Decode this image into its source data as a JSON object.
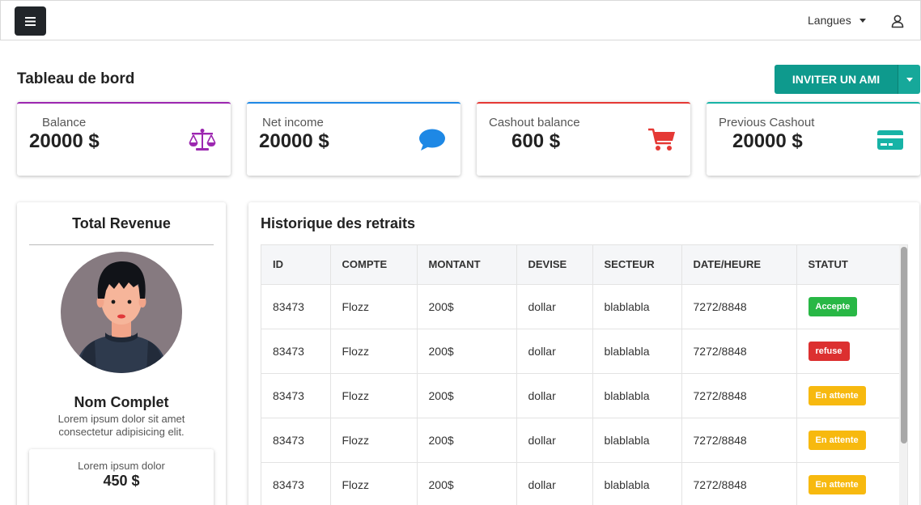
{
  "header": {
    "language_label": "Langues"
  },
  "page": {
    "title": "Tableau de bord",
    "invite_label": "INVITER UN AMI"
  },
  "cards": [
    {
      "label": "Balance",
      "value": "20000 $",
      "icon": "scale-icon",
      "color": "#9c27b0"
    },
    {
      "label": "Net income",
      "value": "20000 $",
      "icon": "chat-bubble-icon",
      "color": "#1e88e5"
    },
    {
      "label": "Cashout balance",
      "value": "600 $",
      "icon": "cart-icon",
      "color": "#e53935"
    },
    {
      "label": "Previous Cashout",
      "value": "20000 $",
      "icon": "credit-card-icon",
      "color": "#17b3a6"
    }
  ],
  "revenue": {
    "title": "Total Revenue",
    "name": "Nom Complet",
    "description": "Lorem ipsum dolor sit amet consectetur adipisicing elit.",
    "mini_label": "Lorem ipsum dolor",
    "mini_value": "450 $"
  },
  "history": {
    "title": "Historique des retraits",
    "columns": [
      "ID",
      "COMPTE",
      "MONTANT",
      "DEVISE",
      "SECTEUR",
      "DATE/HEURE",
      "STATUT"
    ],
    "rows": [
      {
        "id": "83473",
        "compte": "Flozz",
        "montant": "200$",
        "devise": "dollar",
        "secteur": "blablabla",
        "date": "7272/8848",
        "statut": "Accepte",
        "statut_color": "#28b745"
      },
      {
        "id": "83473",
        "compte": "Flozz",
        "montant": "200$",
        "devise": "dollar",
        "secteur": "blablabla",
        "date": "7272/8848",
        "statut": "refuse",
        "statut_color": "#dc3030"
      },
      {
        "id": "83473",
        "compte": "Flozz",
        "montant": "200$",
        "devise": "dollar",
        "secteur": "blablabla",
        "date": "7272/8848",
        "statut": "En attente",
        "statut_color": "#f7b90f"
      },
      {
        "id": "83473",
        "compte": "Flozz",
        "montant": "200$",
        "devise": "dollar",
        "secteur": "blablabla",
        "date": "7272/8848",
        "statut": "En attente",
        "statut_color": "#f7b90f"
      },
      {
        "id": "83473",
        "compte": "Flozz",
        "montant": "200$",
        "devise": "dollar",
        "secteur": "blablabla",
        "date": "7272/8848",
        "statut": "En attente",
        "statut_color": "#f7b90f"
      }
    ]
  },
  "colors": {
    "invite_button": "#0e9a8d",
    "menu_button": "#212529"
  }
}
